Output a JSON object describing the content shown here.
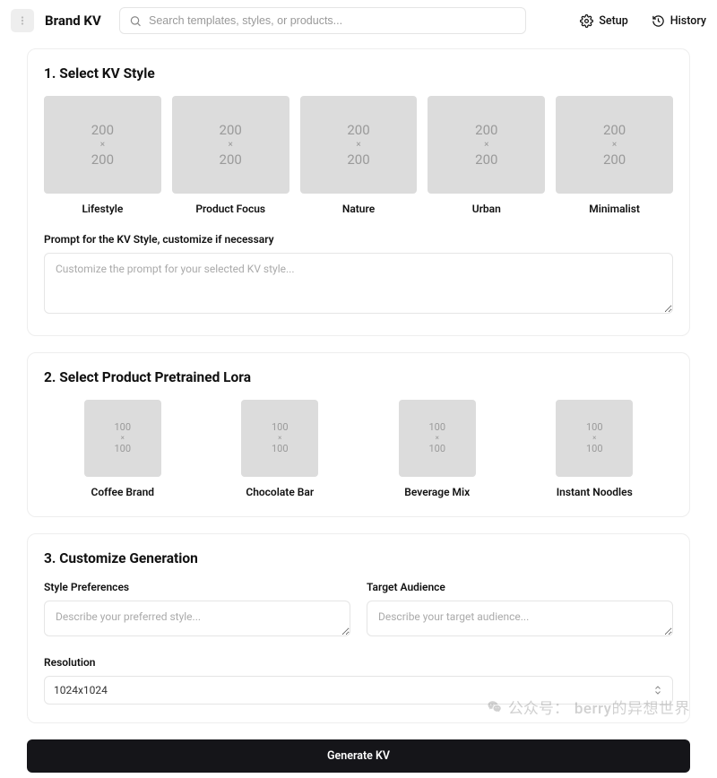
{
  "header": {
    "brand": "Brand KV",
    "search_placeholder": "Search templates, styles, or products...",
    "setup_label": "Setup",
    "history_label": "History"
  },
  "section1": {
    "title": "1. Select KV Style",
    "items": [
      {
        "label": "Lifestyle",
        "w": "200",
        "h": "200"
      },
      {
        "label": "Product Focus",
        "w": "200",
        "h": "200"
      },
      {
        "label": "Nature",
        "w": "200",
        "h": "200"
      },
      {
        "label": "Urban",
        "w": "200",
        "h": "200"
      },
      {
        "label": "Minimalist",
        "w": "200",
        "h": "200"
      }
    ],
    "prompt_label": "Prompt for the KV Style, customize if necessary",
    "prompt_placeholder": "Customize the prompt for your selected KV style..."
  },
  "section2": {
    "title": "2. Select Product Pretrained Lora",
    "items": [
      {
        "label": "Coffee Brand",
        "w": "100",
        "h": "100"
      },
      {
        "label": "Chocolate Bar",
        "w": "100",
        "h": "100"
      },
      {
        "label": "Beverage Mix",
        "w": "100",
        "h": "100"
      },
      {
        "label": "Instant Noodles",
        "w": "100",
        "h": "100"
      }
    ]
  },
  "section3": {
    "title": "3. Customize Generation",
    "style_label": "Style Preferences",
    "style_placeholder": "Describe your preferred style...",
    "audience_label": "Target Audience",
    "audience_placeholder": "Describe your target audience...",
    "resolution_label": "Resolution",
    "resolution_value": "1024x1024"
  },
  "generate_label": "Generate KV",
  "watermark": {
    "prefix": "公众号：",
    "name": "berry的异想世界"
  }
}
